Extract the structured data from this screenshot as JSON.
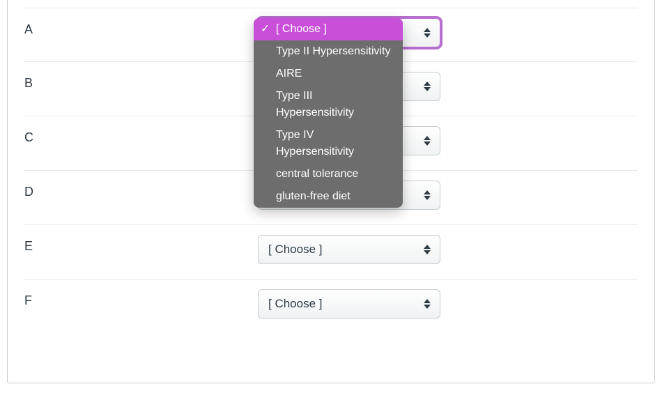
{
  "placeholder": "[ Choose ]",
  "rows": [
    {
      "label": "A",
      "open": true
    },
    {
      "label": "B",
      "open": false
    },
    {
      "label": "C",
      "open": false
    },
    {
      "label": "D",
      "open": false
    },
    {
      "label": "E",
      "open": false
    },
    {
      "label": "F",
      "open": false
    }
  ],
  "options": [
    "[ Choose ]",
    "Type II Hypersensitivity",
    "AIRE",
    "Type III Hypersensitivity",
    "Type IV Hypersensitivity",
    "central tolerance",
    "gluten-free diet"
  ]
}
